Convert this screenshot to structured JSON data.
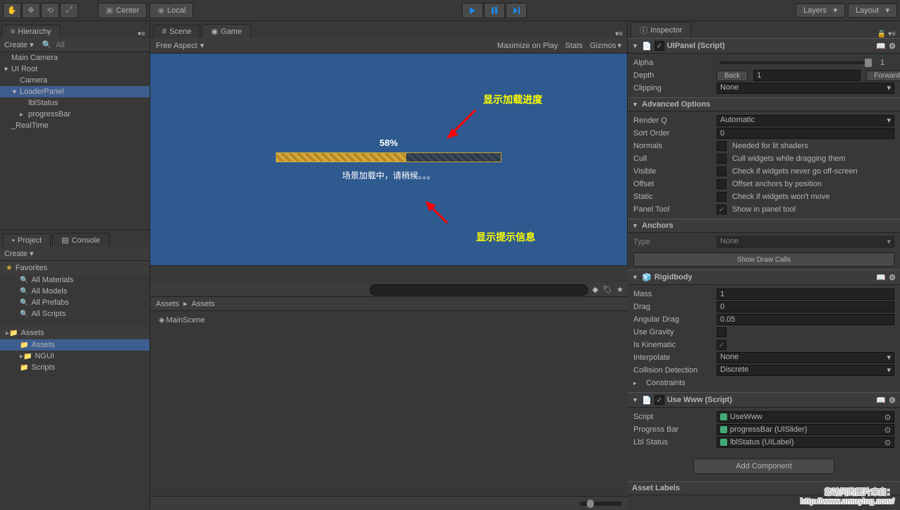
{
  "toolbar": {
    "center_label": "Center",
    "local_label": "Local",
    "layers_label": "Layers",
    "layout_label": "Layout"
  },
  "hierarchy": {
    "tab_label": "Hierarchy",
    "create_label": "Create",
    "search_placeholder": "All",
    "items": [
      {
        "label": "Main Camera",
        "indent": 0
      },
      {
        "label": "UI Root",
        "indent": 0,
        "expanded": true
      },
      {
        "label": "Camera",
        "indent": 1
      },
      {
        "label": "LoaderPanel",
        "indent": 1,
        "selected": true,
        "expanded": true
      },
      {
        "label": "lblStatus",
        "indent": 2
      },
      {
        "label": "progressBar",
        "indent": 2,
        "hasChildren": true
      },
      {
        "label": "_RealTime",
        "indent": 0
      }
    ]
  },
  "scene_tab": "Scene",
  "game_tab": "Game",
  "game_header": {
    "aspect": "Free Aspect",
    "maximize": "Maximize on Play",
    "stats": "Stats",
    "gizmos": "Gizmos"
  },
  "game_content": {
    "progress_percent": "58%",
    "progress_value": 58,
    "status_text": "场景加载中，请稍候。。。",
    "annotation1": "显示加载进度",
    "annotation2": "显示提示信息"
  },
  "project": {
    "tab_project": "Project",
    "tab_console": "Console",
    "create_label": "Create",
    "favorites": "Favorites",
    "fav_items": [
      "All Materials",
      "All Models",
      "All Prefabs",
      "All Scripts"
    ],
    "assets_header": "Assets",
    "folders": [
      "Assets",
      "NGUI",
      "Scripts"
    ],
    "breadcrumb": [
      "Assets",
      "Assets"
    ],
    "content_items": [
      "MainScene"
    ]
  },
  "inspector": {
    "tab_label": "Inspector",
    "uipanel": {
      "title": "UIPanel (Script)",
      "alpha_label": "Alpha",
      "alpha_value": "1",
      "depth_label": "Depth",
      "depth_back": "Back",
      "depth_value": "1",
      "depth_forward": "Forward",
      "clipping_label": "Clipping",
      "clipping_value": "None",
      "advanced_header": "Advanced Options",
      "renderq_label": "Render Q",
      "renderq_value": "Automatic",
      "sortorder_label": "Sort Order",
      "sortorder_value": "0",
      "normals_label": "Normals",
      "normals_desc": "Needed for lit shaders",
      "cull_label": "Cull",
      "cull_desc": "Cull widgets while dragging them",
      "visible_label": "Visible",
      "visible_desc": "Check if widgets never go off-screen",
      "offset_label": "Offset",
      "offset_desc": "Offset anchors by position",
      "static_label": "Static",
      "static_desc": "Check if widgets won't move",
      "paneltool_label": "Panel Tool",
      "paneltool_desc": "Show in panel tool",
      "anchors_header": "Anchors",
      "type_label": "Type",
      "type_value": "None",
      "drawcalls_btn": "Show Draw Calls"
    },
    "rigidbody": {
      "title": "Rigidbody",
      "mass_label": "Mass",
      "mass_value": "1",
      "drag_label": "Drag",
      "drag_value": "0",
      "angulardrag_label": "Angular Drag",
      "angulardrag_value": "0.05",
      "gravity_label": "Use Gravity",
      "kinematic_label": "Is Kinematic",
      "interpolate_label": "Interpolate",
      "interpolate_value": "None",
      "collision_label": "Collision Detection",
      "collision_value": "Discrete",
      "constraints_label": "Constraints"
    },
    "usewww": {
      "title": "Use Www (Script)",
      "script_label": "Script",
      "script_value": "UseWww",
      "progressbar_label": "Progress Bar",
      "progressbar_value": "progressBar (UISlider)",
      "lblstatus_label": "Lbl Status",
      "lblstatus_value": "lblStatus (UILabel)"
    },
    "add_component": "Add Component",
    "asset_labels": "Asset Labels"
  },
  "watermark": {
    "line1": "您访问的图片来自：",
    "line2": "http://www.omuying.com/"
  }
}
